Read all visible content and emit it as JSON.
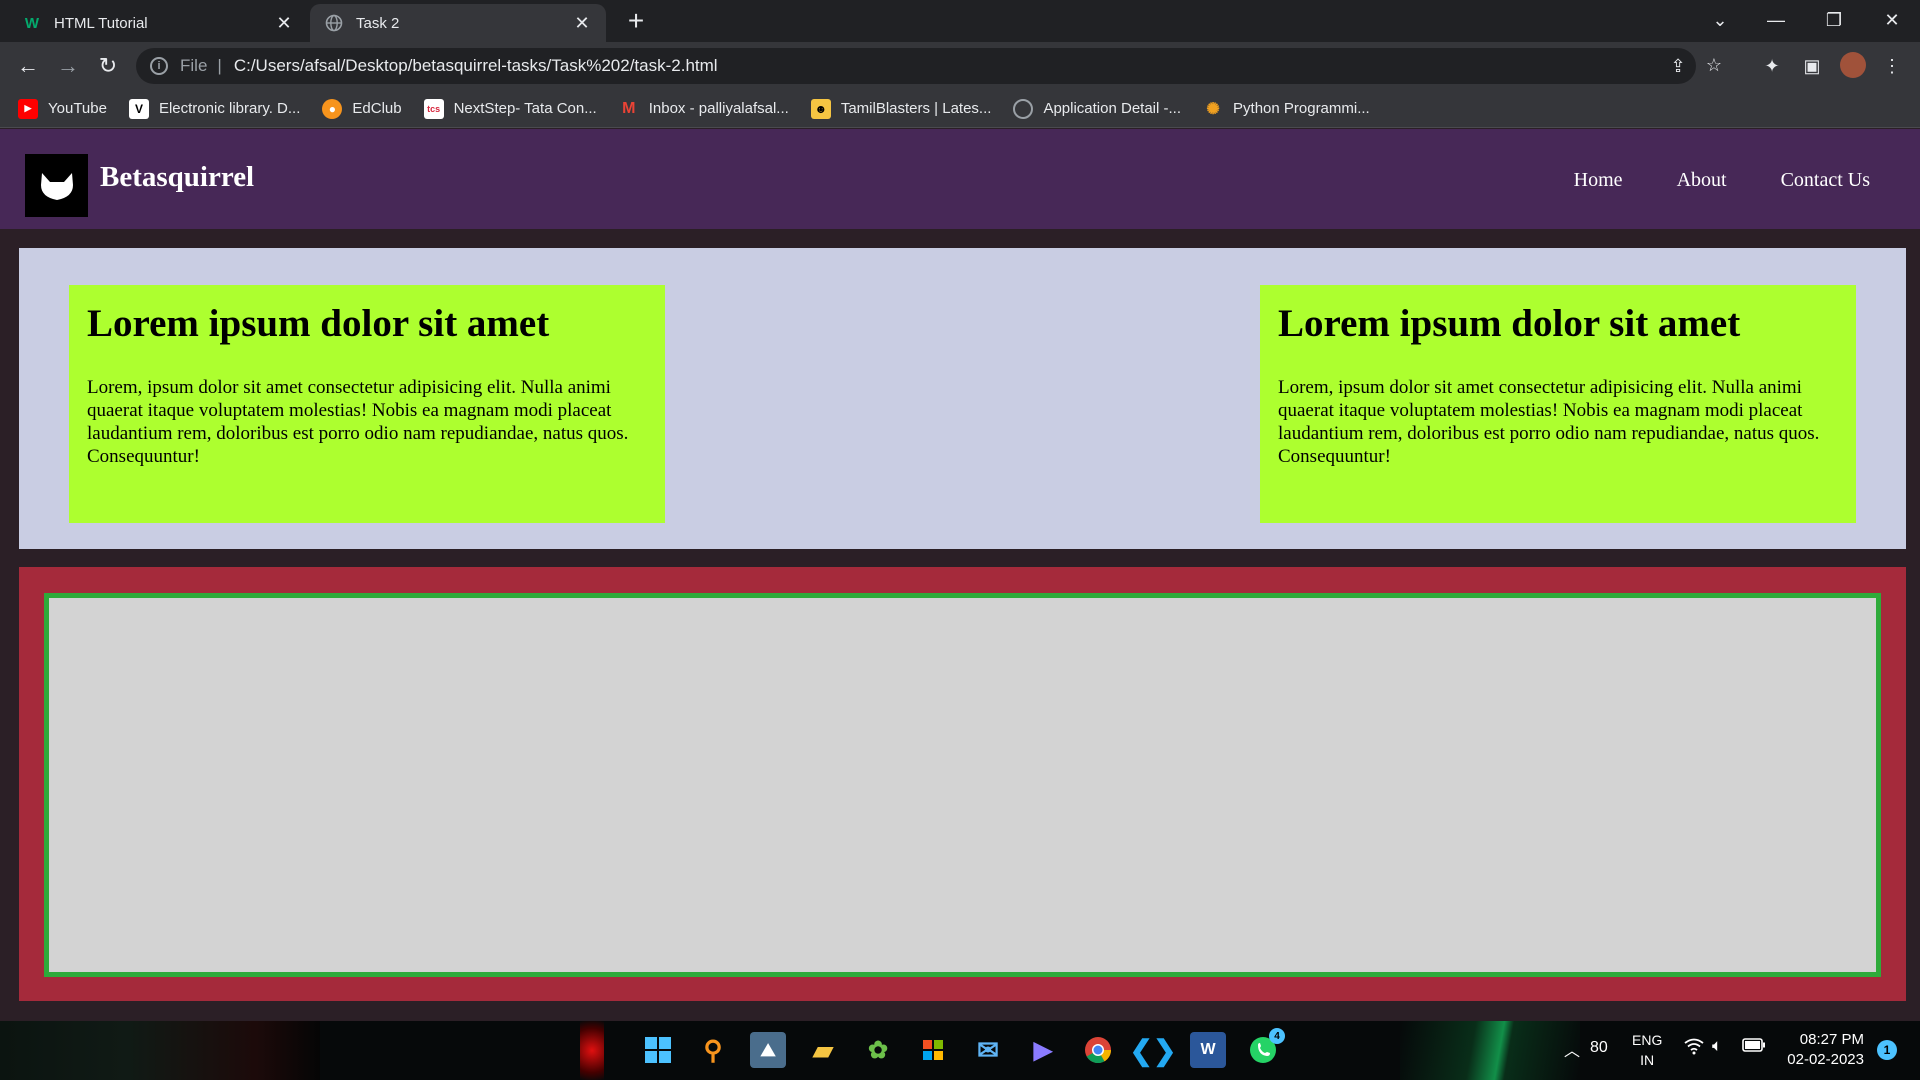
{
  "browser": {
    "tabs": [
      {
        "title": "HTML Tutorial",
        "favicon": "w3schools-icon",
        "active": false
      },
      {
        "title": "Task 2",
        "favicon": "globe-icon",
        "active": true
      }
    ],
    "address": {
      "scheme": "File",
      "url": "C:/Users/afsal/Desktop/betasquirrel-tasks/Task%202/task-2.html"
    },
    "bookmarks": [
      {
        "label": "YouTube",
        "color": "#ff0000"
      },
      {
        "label": "Electronic library. D...",
        "color": "#ffffff"
      },
      {
        "label": "EdClub",
        "color": "#f7941d"
      },
      {
        "label": "NextStep- Tata Con...",
        "color": "#ffffff"
      },
      {
        "label": "Inbox - palliyalafsal...",
        "color": "#ea4335"
      },
      {
        "label": "TamilBlasters | Lates...",
        "color": "#f5c542"
      },
      {
        "label": "Application Detail -...",
        "color": "#9aa0a6"
      },
      {
        "label": "Python Programmi...",
        "color": "#f0a020"
      }
    ]
  },
  "site": {
    "brand": "Betasquirrel",
    "nav": [
      "Home",
      "About",
      "Contact Us"
    ],
    "cards": [
      {
        "title": "Lorem ipsum dolor sit amet",
        "body": "Lorem, ipsum dolor sit amet consectetur adipisicing elit. Nulla animi quaerat itaque voluptatem molestias! Nobis ea magnam modi placeat laudantium rem, doloribus est porro odio nam repudiandae, natus quos. Consequuntur!"
      },
      {
        "title": "Lorem ipsum dolor sit amet",
        "body": "Lorem, ipsum dolor sit amet consectetur adipisicing elit. Nulla animi quaerat itaque voluptatem molestias! Nobis ea magnam modi placeat laudantium rem, doloribus est porro odio nam repudiandae, natus quos. Consequuntur!"
      }
    ],
    "colors": {
      "navbar": "#472857",
      "section1": "#c9cde3",
      "card": "#adff2f",
      "section2": "#a52a3b",
      "inner_border": "#2eaa3a"
    }
  },
  "taskbar": {
    "tray": {
      "temp": "80",
      "lang_line1": "ENG",
      "lang_line2": "IN"
    },
    "clock": {
      "time": "08:27 PM",
      "date": "02-02-2023"
    },
    "whatsapp_badge": "4",
    "notification_count": "1"
  }
}
